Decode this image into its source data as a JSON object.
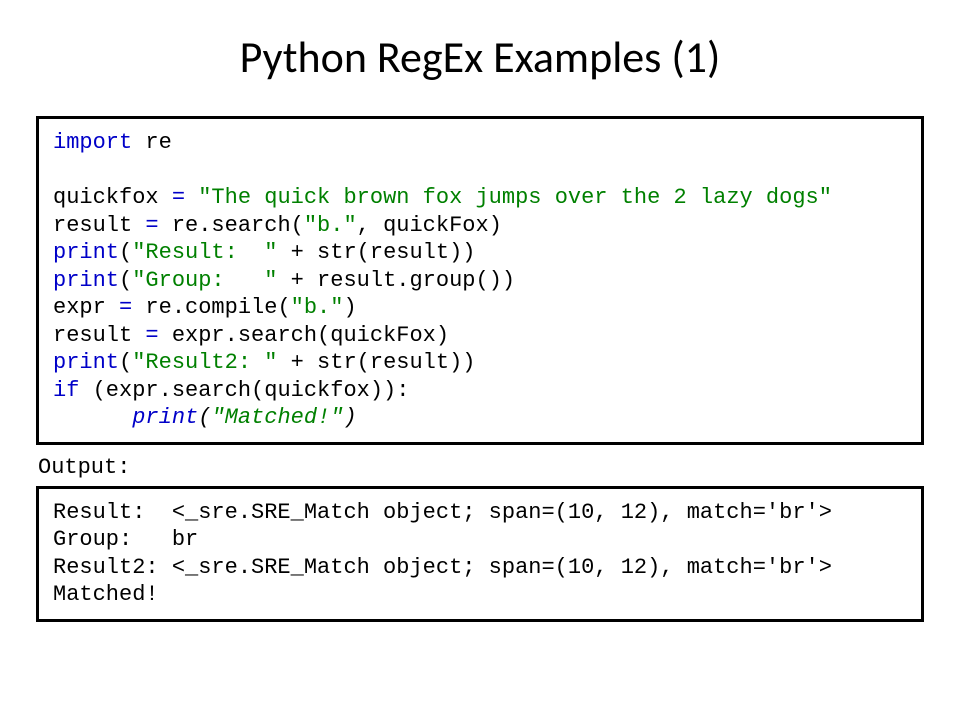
{
  "title": "Python RegEx Examples (1)",
  "code": {
    "l1a": "import",
    "l1b": " re",
    "l2a": "quickfox ",
    "l2b": "=",
    "l2c": " \"The quick brown fox jumps over the 2 lazy dogs\"",
    "l3a": "result ",
    "l3b": "=",
    "l3c": " re.search(",
    "l3d": "\"b.\"",
    "l3e": ", quickFox)",
    "l4a": "print",
    "l4b": "(",
    "l4c": "\"Result:  \"",
    "l4d": " + str(result))",
    "l5a": "print",
    "l5b": "(",
    "l5c": "\"Group:   \"",
    "l5d": " + result.group())",
    "l6a": "expr ",
    "l6b": "=",
    "l6c": " re.compile(",
    "l6d": "\"b.\"",
    "l6e": ")",
    "l7a": "result ",
    "l7b": "=",
    "l7c": " expr.search(quickFox)",
    "l8a": "print",
    "l8b": "(",
    "l8c": "\"Result2: \"",
    "l8d": " + str(result))",
    "l9a": "if",
    "l9b": " (expr.search(quickfox)):",
    "l10a": "      print",
    "l10b": "(",
    "l10c": "\"Matched!\"",
    "l10d": ")"
  },
  "output_label": "Output:",
  "output": {
    "l1": "Result:  <_sre.SRE_Match object; span=(10, 12), match='br'>",
    "l2": "Group:   br",
    "l3": "Result2: <_sre.SRE_Match object; span=(10, 12), match='br'>",
    "l4": "Matched!"
  }
}
